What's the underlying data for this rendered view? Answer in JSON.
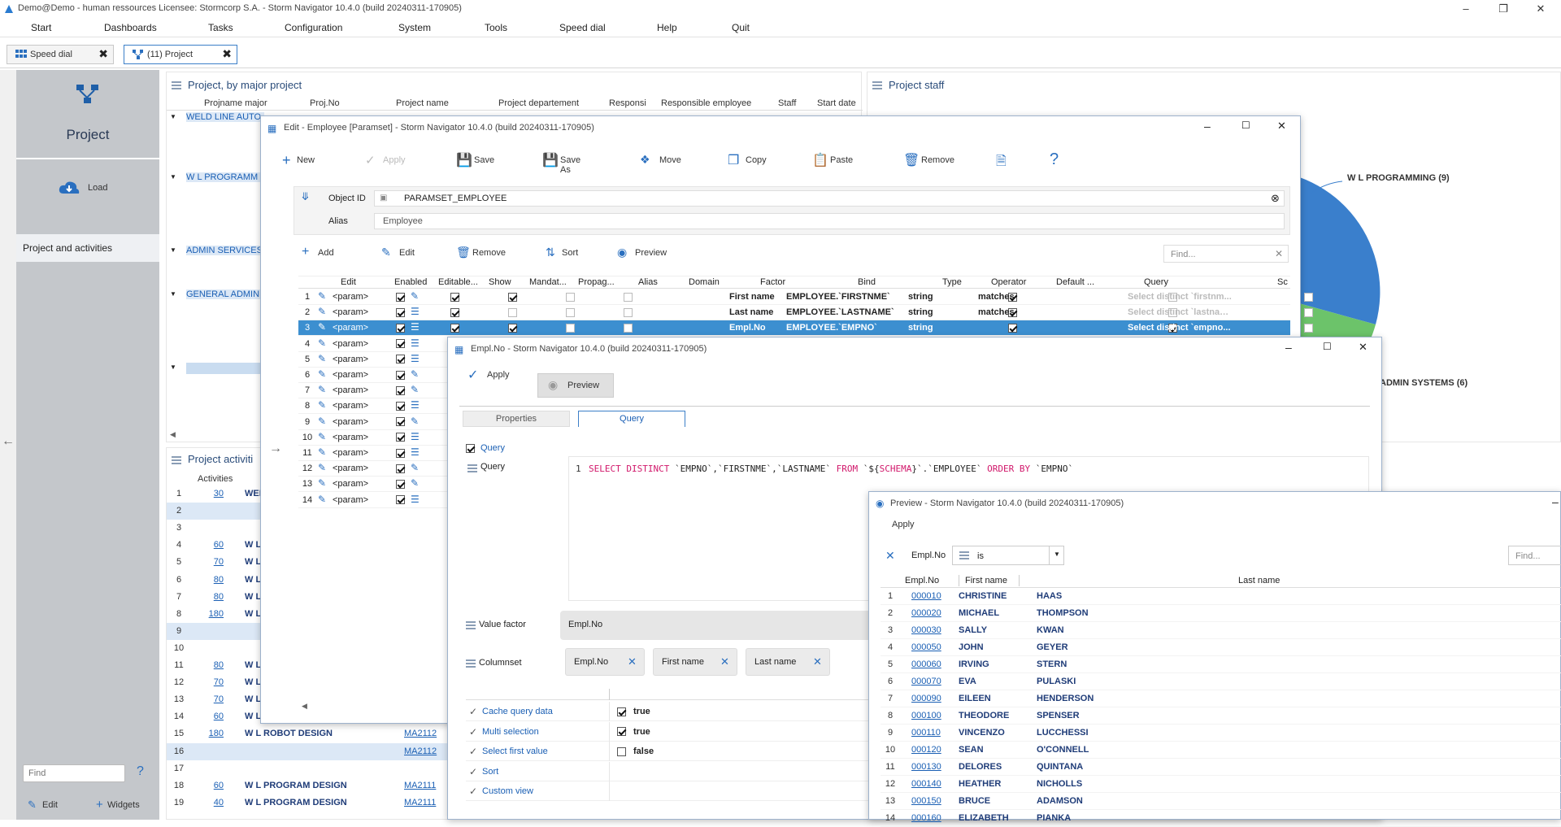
{
  "window": {
    "title": "Demo@Demo - human ressources   Licensee: Stormcorp S.A. -  Storm Navigator 10.4.0 (build 20240311-170905)"
  },
  "menu": [
    "Start",
    "Dashboards",
    "Tasks",
    "Configuration",
    "System",
    "Tools",
    "Speed dial",
    "Help",
    "Quit"
  ],
  "tabs": [
    {
      "label": "Speed dial"
    },
    {
      "label": "(11) Project"
    }
  ],
  "sidebar": {
    "title": "Project",
    "load": "Load",
    "item": "Project and activities",
    "find_placeholder": "Find",
    "help": "?",
    "edit": "Edit",
    "widgets": "Widgets"
  },
  "project_panel": {
    "title": "Project, by major project",
    "columns": [
      "Projname major",
      "Proj.No",
      "Project name",
      "Project departement",
      "Responsi",
      "Responsible employee",
      "Staff",
      "Start date"
    ],
    "groups": [
      "WELD LINE AUTO",
      "W L PROGRAMM",
      "ADMIN SERVICES",
      "GENERAL ADMIN"
    ]
  },
  "staff_panel": {
    "title": "Project staff",
    "labels": [
      "W L PROGRAMMING (9)",
      "ADMIN SYSTEMS (6)"
    ]
  },
  "activities_panel": {
    "title": "Project activiti",
    "col": "Activities",
    "rows": [
      {
        "n": "1",
        "v": "30",
        "name": "WEI",
        "code": ""
      },
      {
        "n": "2",
        "v": "",
        "name": "",
        "code": ""
      },
      {
        "n": "3",
        "v": "",
        "name": "",
        "code": ""
      },
      {
        "n": "4",
        "v": "60",
        "name": "W L",
        "code": ""
      },
      {
        "n": "5",
        "v": "70",
        "name": "W L",
        "code": ""
      },
      {
        "n": "6",
        "v": "80",
        "name": "W L",
        "code": ""
      },
      {
        "n": "7",
        "v": "80",
        "name": "W L",
        "code": ""
      },
      {
        "n": "8",
        "v": "180",
        "name": "W L",
        "code": ""
      },
      {
        "n": "9",
        "v": "",
        "name": "",
        "code": ""
      },
      {
        "n": "10",
        "v": "",
        "name": "",
        "code": ""
      },
      {
        "n": "11",
        "v": "80",
        "name": "W L",
        "code": ""
      },
      {
        "n": "12",
        "v": "70",
        "name": "W L",
        "code": ""
      },
      {
        "n": "13",
        "v": "70",
        "name": "W L",
        "code": ""
      },
      {
        "n": "14",
        "v": "60",
        "name": "W L",
        "code": ""
      },
      {
        "n": "15",
        "v": "180",
        "name": "W L ROBOT DESIGN",
        "code": "MA2112"
      },
      {
        "n": "16",
        "v": "",
        "name": "",
        "code": "MA2112"
      },
      {
        "n": "17",
        "v": "",
        "name": "",
        "code": ""
      },
      {
        "n": "18",
        "v": "60",
        "name": "W L PROGRAM DESIGN",
        "code": "MA2111"
      },
      {
        "n": "19",
        "v": "40",
        "name": "W L PROGRAM DESIGN",
        "code": "MA2111"
      }
    ]
  },
  "edit_dialog": {
    "title": "Edit - Employee [Paramset] -  Storm Navigator 10.4.0 (build 20240311-170905)",
    "toolbar": [
      "New",
      "Apply",
      "Save",
      "Save As",
      "Move",
      "Copy",
      "Paste",
      "Remove"
    ],
    "object_id_label": "Object ID",
    "object_id_value": "PARAMSET_EMPLOYEE",
    "alias_label": "Alias",
    "alias_value": "Employee",
    "subtoolbar": [
      "Add",
      "Edit",
      "Remove",
      "Sort",
      "Preview"
    ],
    "find_placeholder": "Find...",
    "columns": [
      "Edit",
      "Enabled",
      "Editable...",
      "Show",
      "Mandat...",
      "Propag...",
      "Alias",
      "Domain",
      "Factor",
      "Bind",
      "Type",
      "Operator",
      "Default ...",
      "Query",
      "Sc"
    ],
    "rows": [
      {
        "n": "1",
        "p": "<param>",
        "factor": "First name",
        "bind": "EMPLOYEE.`FIRSTNME`",
        "type": "string",
        "op": "matches",
        "query": "Select distinct `firstnm..."
      },
      {
        "n": "2",
        "p": "<param>",
        "factor": "Last name",
        "bind": "EMPLOYEE.`LASTNAME`",
        "type": "string",
        "op": "matches",
        "query": "Select distinct `lastname`..."
      },
      {
        "n": "3",
        "p": "<param>",
        "factor": "Empl.No",
        "bind": "EMPLOYEE.`EMPNO`",
        "type": "string",
        "op": "",
        "query": "Select distinct `empno..."
      },
      {
        "n": "4",
        "p": "<param>"
      },
      {
        "n": "5",
        "p": "<param>"
      },
      {
        "n": "6",
        "p": "<param>"
      },
      {
        "n": "7",
        "p": "<param>"
      },
      {
        "n": "8",
        "p": "<param>"
      },
      {
        "n": "9",
        "p": "<param>"
      },
      {
        "n": "10",
        "p": "<param>"
      },
      {
        "n": "11",
        "p": "<param>"
      },
      {
        "n": "12",
        "p": "<param>"
      },
      {
        "n": "13",
        "p": "<param>"
      },
      {
        "n": "14",
        "p": "<param>"
      }
    ]
  },
  "emplno_dialog": {
    "title": "Empl.No -  Storm Navigator 10.4.0 (build 20240311-170905)",
    "apply": "Apply",
    "preview": "Preview",
    "tabs": [
      "Properties",
      "Query"
    ],
    "query_check": "Query",
    "query_label": "Query",
    "line_no": "1",
    "sql_kw1": "SELECT DISTINCT",
    "sql_p1": " `EMPNO`,`FIRSTNME`,`LASTNAME` ",
    "sql_kw2": "FROM",
    "sql_p2": " `${",
    "sql_schema": "SCHEMA",
    "sql_p3": "}`.`EMPLOYEE` ",
    "sql_kw3": "ORDER BY",
    "sql_p4": " `EMPNO`",
    "value_factor_label": "Value factor",
    "value_factor": "Empl.No",
    "columnset_label": "Columnset",
    "columnset": [
      "Empl.No",
      "First name",
      "Last name"
    ],
    "props": [
      {
        "label": "Cache query data",
        "val": "true",
        "on": true
      },
      {
        "label": "Multi selection",
        "val": "true",
        "on": true
      },
      {
        "label": "Select first value",
        "val": "false",
        "on": false
      },
      {
        "label": "Sort",
        "val": "",
        "on": null
      },
      {
        "label": "Custom view",
        "val": "",
        "on": null
      }
    ]
  },
  "preview_dialog": {
    "title": "Preview -  Storm Navigator 10.4.0 (build 20240311-170905)",
    "apply": "Apply",
    "filter_field": "Empl.No",
    "filter_op": "is",
    "find_placeholder": "Find...",
    "columns": [
      "Empl.No",
      "First name",
      "Last name"
    ],
    "rows": [
      {
        "n": "1",
        "no": "000010",
        "first": "CHRISTINE",
        "last": "HAAS"
      },
      {
        "n": "2",
        "no": "000020",
        "first": "MICHAEL",
        "last": "THOMPSON"
      },
      {
        "n": "3",
        "no": "000030",
        "first": "SALLY",
        "last": "KWAN"
      },
      {
        "n": "4",
        "no": "000050",
        "first": "JOHN",
        "last": "GEYER"
      },
      {
        "n": "5",
        "no": "000060",
        "first": "IRVING",
        "last": "STERN"
      },
      {
        "n": "6",
        "no": "000070",
        "first": "EVA",
        "last": "PULASKI"
      },
      {
        "n": "7",
        "no": "000090",
        "first": "EILEEN",
        "last": "HENDERSON"
      },
      {
        "n": "8",
        "no": "000100",
        "first": "THEODORE",
        "last": "SPENSER"
      },
      {
        "n": "9",
        "no": "000110",
        "first": "VINCENZO",
        "last": "LUCCHESSI"
      },
      {
        "n": "10",
        "no": "000120",
        "first": "SEAN",
        "last": "O'CONNELL"
      },
      {
        "n": "11",
        "no": "000130",
        "first": "DELORES",
        "last": "QUINTANA"
      },
      {
        "n": "12",
        "no": "000140",
        "first": "HEATHER",
        "last": "NICHOLLS"
      },
      {
        "n": "13",
        "no": "000150",
        "first": "BRUCE",
        "last": "ADAMSON"
      },
      {
        "n": "14",
        "no": "000160",
        "first": "ELIZABETH",
        "last": "PIANKA"
      }
    ]
  }
}
